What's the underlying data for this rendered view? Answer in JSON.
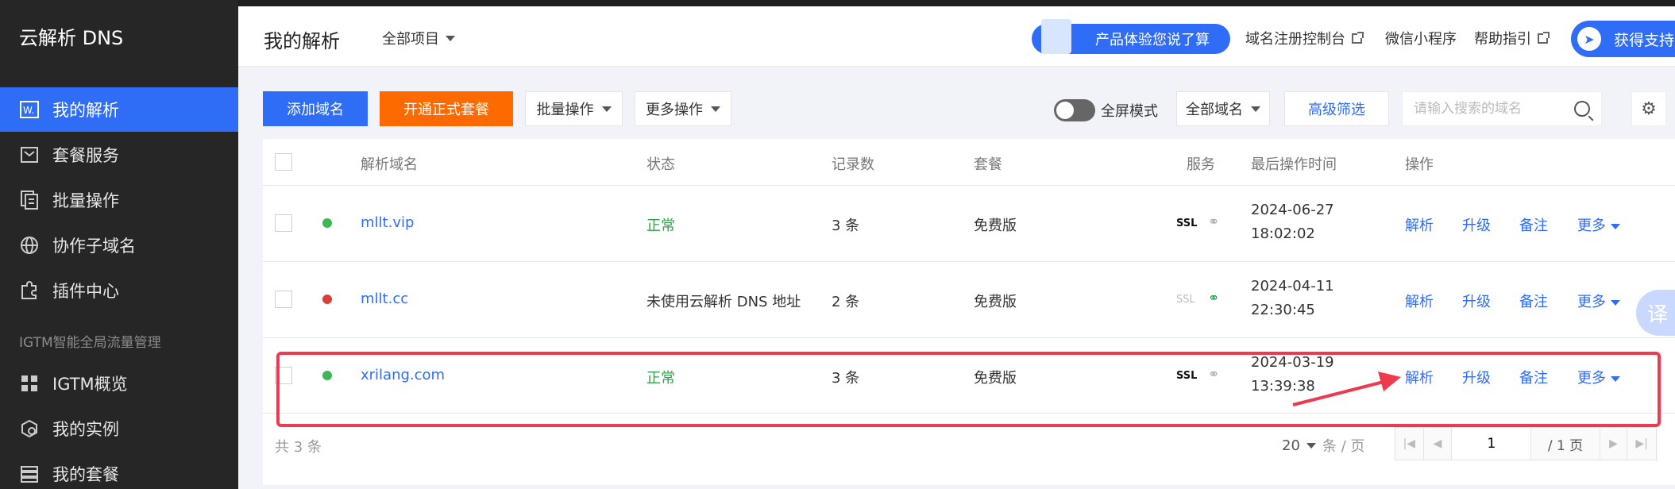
{
  "sidebar": {
    "title": "云解析 DNS",
    "items": [
      {
        "label": "我的解析",
        "icon": "domain-icon",
        "active": true
      },
      {
        "label": "套餐服务",
        "icon": "package-icon"
      },
      {
        "label": "批量操作",
        "icon": "batch-icon"
      },
      {
        "label": "协作子域名",
        "icon": "globe-icon"
      },
      {
        "label": "插件中心",
        "icon": "plugin-icon"
      }
    ],
    "section_label": "IGTM智能全局流量管理",
    "section_items": [
      {
        "label": "IGTM概览",
        "icon": "grid-icon"
      },
      {
        "label": "我的实例",
        "icon": "instance-icon"
      },
      {
        "label": "我的套餐",
        "icon": "list-icon"
      }
    ]
  },
  "header": {
    "title": "我的解析",
    "project_select": "全部项目",
    "feedback_pill": "产品体验您说了算",
    "links": [
      "域名注册控制台",
      "微信小程序",
      "帮助指引"
    ],
    "support": "获得支持"
  },
  "toolbar": {
    "add_domain": "添加域名",
    "open_package": "开通正式套餐",
    "batch_ops": "批量操作",
    "more_ops": "更多操作",
    "fullscreen_label": "全屏模式",
    "domain_filter": "全部域名",
    "advanced_filter": "高级筛选",
    "search_placeholder": "请输入搜索的域名"
  },
  "table": {
    "columns": [
      "解析域名",
      "状态",
      "记录数",
      "套餐",
      "服务",
      "最后操作时间",
      "操作"
    ],
    "rows": [
      {
        "domain": "mllt.vip",
        "status": "正常",
        "status_color": "#29a745",
        "dot_color": "#3cb754",
        "records": "3 条",
        "plan": "免费版",
        "ssl": "SSL",
        "ssl_active": true,
        "share_active": false,
        "date": "2024-06-27",
        "time": "18:02:02"
      },
      {
        "domain": "mllt.cc",
        "status": "未使用云解析 DNS 地址",
        "status_color": "#333333",
        "dot_color": "#d9403a",
        "records": "2 条",
        "plan": "免费版",
        "ssl": "SSL",
        "ssl_active": false,
        "share_active": true,
        "date": "2024-04-11",
        "time": "22:30:45"
      },
      {
        "domain": "xrilang.com",
        "status": "正常",
        "status_color": "#29a745",
        "dot_color": "#3cb754",
        "records": "3 条",
        "plan": "免费版",
        "ssl": "SSL",
        "ssl_active": true,
        "share_active": false,
        "date": "2024-03-19",
        "time": "13:39:38"
      }
    ],
    "actions": [
      "解析",
      "升级",
      "备注",
      "更多"
    ]
  },
  "footer": {
    "total": "共 3 条",
    "page_size": "20",
    "per_page_suffix": "条 / 页",
    "current_page": "1",
    "total_pages": "/ 1 页"
  },
  "translate_tab": "译",
  "colors": {
    "accent": "#2f6df6",
    "orange": "#ff6a00",
    "highlight": "#ee3a4f",
    "sidebar_bg": "#262626"
  }
}
